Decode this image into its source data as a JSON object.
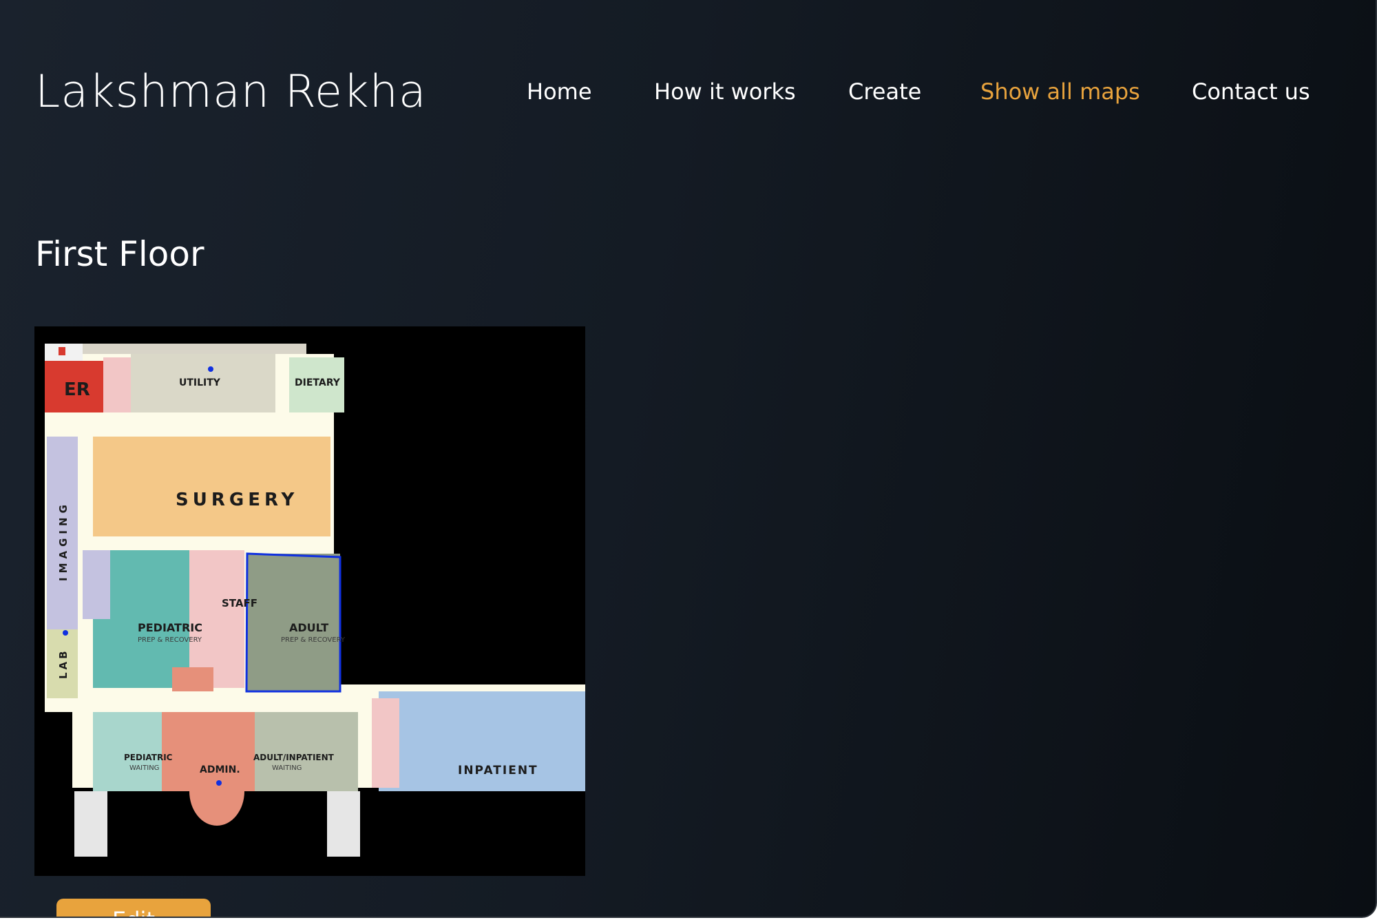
{
  "brand": {
    "name": "Lakshman Rekha"
  },
  "nav": {
    "items": [
      {
        "label": "Home"
      },
      {
        "label": "How it works"
      },
      {
        "label": "Create"
      },
      {
        "label": "Show all maps",
        "active": true
      },
      {
        "label": "Contact us"
      }
    ]
  },
  "page": {
    "title": "First Floor"
  },
  "floor_map": {
    "labels": {
      "er": "ER",
      "utility": "UTILITY",
      "dietary": "DIETARY",
      "surgery": "SURGERY",
      "imaging": "IMAGING",
      "lab": "LAB",
      "staff": "STAFF",
      "pediatric": "PEDIATRIC",
      "pediatric_sub": "PREP & RECOVERY",
      "adult": "ADULT",
      "adult_sub": "PREP & RECOVERY",
      "pediatric_waiting": "PEDIATRIC",
      "pediatric_waiting_sub": "WAITING",
      "admin": "ADMIN.",
      "adult_inpatient_waiting": "ADULT/INPATIENT",
      "adult_inpatient_waiting_sub": "WAITING",
      "inpatient": "INPATIENT"
    },
    "highlight_color": "#1030e0"
  },
  "actions": {
    "edit_label": "Edit"
  },
  "colors": {
    "accent": "#e8a33d",
    "background": "#141b24",
    "text": "#ffffff"
  }
}
